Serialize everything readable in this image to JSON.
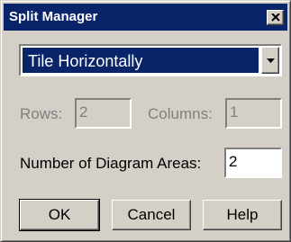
{
  "window": {
    "title": "Split Manager",
    "close_icon": "close-icon"
  },
  "layout_select": {
    "value": "Tile Horizontally",
    "arrow_icon": "chevron-down-icon"
  },
  "rows": {
    "label": "Rows:",
    "value": "2",
    "enabled": false
  },
  "columns": {
    "label": "Columns:",
    "value": "1",
    "enabled": false
  },
  "diagram_areas": {
    "label": "Number of Diagram Areas:",
    "value": "2"
  },
  "buttons": {
    "ok": "OK",
    "cancel": "Cancel",
    "help": "Help"
  },
  "colors": {
    "titlebar": "#0a246a",
    "face": "#d4d0c8",
    "disabled_text": "#808080"
  }
}
